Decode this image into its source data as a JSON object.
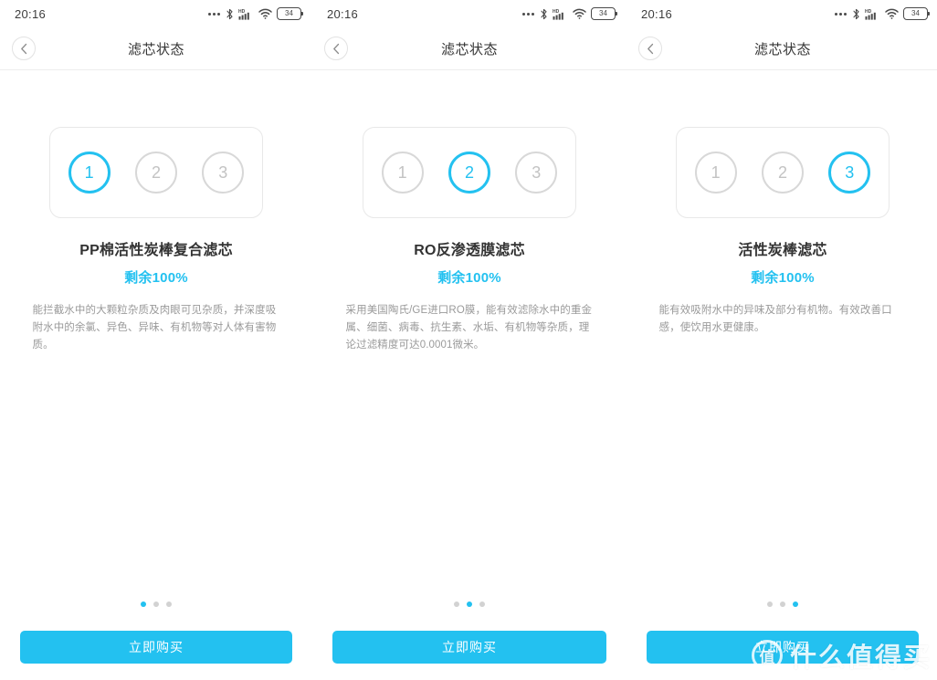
{
  "accent_color": "#23c1f0",
  "status_bar": {
    "time": "20:16",
    "icons": [
      "three-dots-icon",
      "bluetooth-icon",
      "signal-hd-icon",
      "wifi-icon",
      "battery-icon"
    ],
    "battery_level": "34"
  },
  "nav": {
    "title": "滤芯状态",
    "back_icon": "chevron-left-icon"
  },
  "buy_button_label": "立即购买",
  "watermark": {
    "logo_char": "值",
    "text": "什么值得买"
  },
  "steps": [
    "1",
    "2",
    "3"
  ],
  "screens": [
    {
      "active_step": 1,
      "filter_name": "PP棉活性炭棒复合滤芯",
      "remaining": "剩余100%",
      "description": "能拦截水中的大颗粒杂质及肉眼可见杂质，并深度吸附水中的余氯、异色、异味、有机物等对人体有害物质。",
      "active_dot": 1
    },
    {
      "active_step": 2,
      "filter_name": "RO反渗透膜滤芯",
      "remaining": "剩余100%",
      "description": "采用美国陶氏/GE进口RO膜，能有效滤除水中的重金属、细菌、病毒、抗生素、水垢、有机物等杂质，理论过滤精度可达0.0001微米。",
      "active_dot": 2
    },
    {
      "active_step": 3,
      "filter_name": "活性炭棒滤芯",
      "remaining": "剩余100%",
      "description": "能有效吸附水中的异味及部分有机物。有效改善口感，使饮用水更健康。",
      "active_dot": 3
    }
  ]
}
